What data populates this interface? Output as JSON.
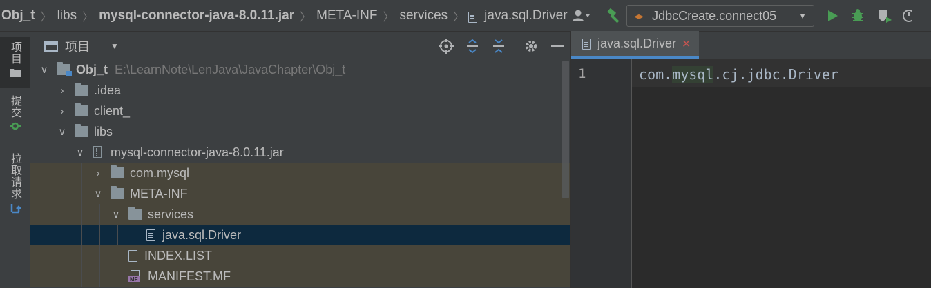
{
  "breadcrumbs": [
    {
      "label": "Obj_t",
      "bold": true
    },
    {
      "label": "libs",
      "bold": false
    },
    {
      "label": "mysql-connector-java-8.0.11.jar",
      "bold": true
    },
    {
      "label": "META-INF",
      "bold": false
    },
    {
      "label": "services",
      "bold": false
    },
    {
      "label": "java.sql.Driver",
      "bold": false
    }
  ],
  "toolbar": {
    "run_config": "JdbcCreate.connect05",
    "icons": [
      "user-icon",
      "hammer-icon",
      "run-icon",
      "debug-icon",
      "coverage-icon",
      "profile-icon"
    ]
  },
  "stripe": {
    "project": "项目",
    "commit": "提交",
    "pull_requests": "拉取请求"
  },
  "panel": {
    "title": "项目",
    "tools": [
      "locate-icon",
      "expand-all-icon",
      "collapse-all-icon",
      "settings-icon",
      "hide-icon"
    ]
  },
  "tree": {
    "root_label": "Obj_t",
    "root_path": "E:\\LearnNote\\LenJava\\JavaChapter\\Obj_t",
    "idea": ".idea",
    "client": "client_",
    "libs": "libs",
    "jar": "mysql-connector-java-8.0.11.jar",
    "com_mysql": "com.mysql",
    "meta_inf": "META-INF",
    "services": "services",
    "driver": "java.sql.Driver",
    "index_list": "INDEX.LIST",
    "manifest": "MANIFEST.MF",
    "mf_badge": "MF"
  },
  "editor": {
    "tab_label": "java.sql.Driver",
    "line_number": "1",
    "code_before": "com.",
    "code_hl": "mysql",
    "code_after": ".cj.jdbc.Driver"
  },
  "colors": {
    "background": "#2b2b2b",
    "panel": "#3c3f41",
    "library_row": "#48453a",
    "selected_row": "#0d293e",
    "accent": "#4a88c7",
    "run_green": "#499c54"
  }
}
